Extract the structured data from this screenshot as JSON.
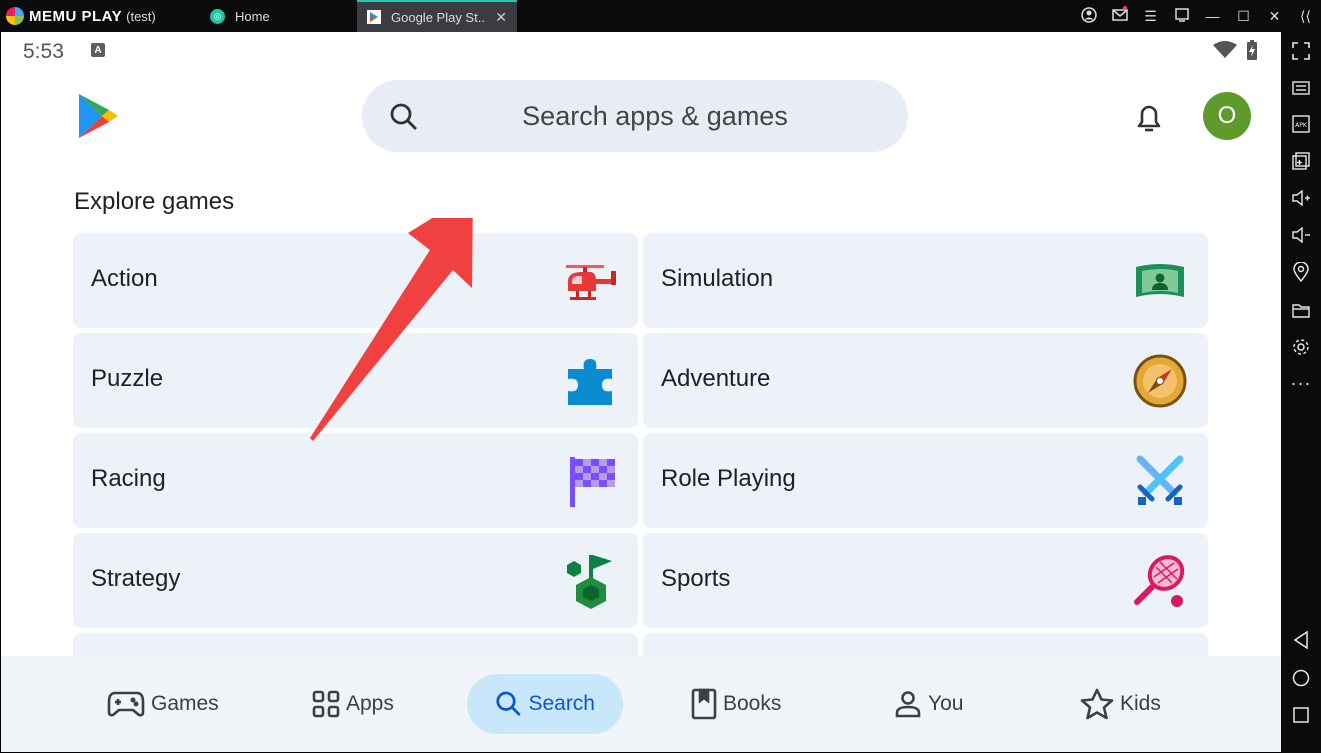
{
  "titlebar": {
    "brand": "MEMU PLAY",
    "brand_sub": "(test)",
    "tabs": [
      {
        "label": "Home"
      },
      {
        "label": "Google Play St.."
      }
    ]
  },
  "status": {
    "time": "5:53",
    "badge": "A"
  },
  "search": {
    "placeholder": "Search apps & games"
  },
  "account": {
    "initial": "O"
  },
  "section": {
    "title": "Explore games"
  },
  "categories": [
    {
      "label": "Action",
      "icon": "helicopter-icon"
    },
    {
      "label": "Simulation",
      "icon": "stadium-icon"
    },
    {
      "label": "Puzzle",
      "icon": "puzzle-icon"
    },
    {
      "label": "Adventure",
      "icon": "compass-icon"
    },
    {
      "label": "Racing",
      "icon": "checkered-flag-icon"
    },
    {
      "label": "Role Playing",
      "icon": "crossed-swords-icon"
    },
    {
      "label": "Strategy",
      "icon": "strategy-flag-icon"
    },
    {
      "label": "Sports",
      "icon": "tennis-racket-icon"
    }
  ],
  "bottom_nav": [
    {
      "label": "Games"
    },
    {
      "label": "Apps"
    },
    {
      "label": "Search"
    },
    {
      "label": "Books"
    },
    {
      "label": "You"
    },
    {
      "label": "Kids"
    }
  ],
  "colors": {
    "accent": "#0b57d0",
    "active_nav_bg": "#c9e7fb",
    "card_bg": "#edf1f8",
    "avatar_bg": "#5f9a2c",
    "annotation_arrow": "#f04040"
  }
}
